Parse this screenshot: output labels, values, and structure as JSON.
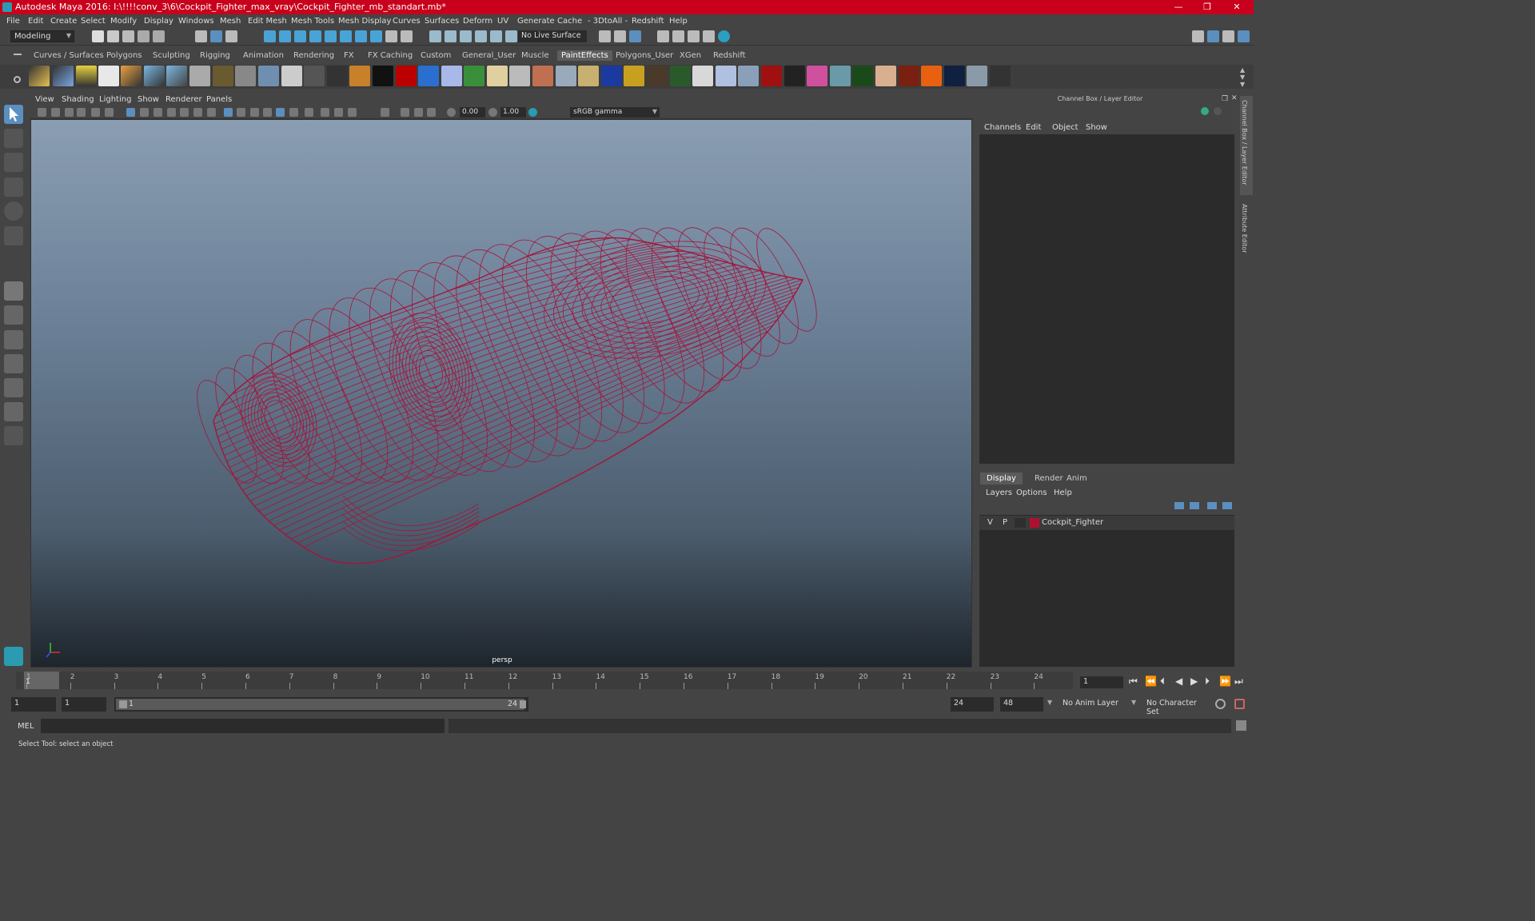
{
  "window": {
    "title": "Autodesk Maya 2016: I:\\!!!!conv_3\\6\\Cockpit_Fighter_max_vray\\Cockpit_Fighter_mb_standart.mb*",
    "minimize": "—",
    "maximize": "❐",
    "close": "✕"
  },
  "menus": [
    "File",
    "Edit",
    "Create",
    "Select",
    "Modify",
    "Display",
    "Windows",
    "Mesh",
    "Edit Mesh",
    "Mesh Tools",
    "Mesh Display",
    "Curves",
    "Surfaces",
    "Deform",
    "UV",
    "Generate",
    "Cache",
    "- 3DtoAll -",
    "Redshift",
    "Help"
  ],
  "status_line": {
    "mode": "Modeling",
    "live_surface": "No Live Surface"
  },
  "shelf_tabs": [
    "Curves / Surfaces",
    "Polygons",
    "Sculpting",
    "Rigging",
    "Animation",
    "Rendering",
    "FX",
    "FX Caching",
    "Custom",
    "General_User",
    "Muscle",
    "PaintEffects",
    "Polygons_User",
    "XGen",
    "Redshift"
  ],
  "active_shelf": "PaintEffects",
  "viewport": {
    "menu": [
      "View",
      "Shading",
      "Lighting",
      "Show",
      "Renderer",
      "Panels"
    ],
    "exposure": "0.00",
    "gamma": "1.00",
    "color_space": "sRGB gamma",
    "camera_label": "persp",
    "mesh_color": "#a3163a"
  },
  "channel_box": {
    "title": "Channel Box / Layer Editor",
    "menu": [
      "Channels",
      "Edit",
      "Object",
      "Show"
    ]
  },
  "layer_editor": {
    "tabs": [
      "Display",
      "Render",
      "Anim"
    ],
    "active_tab": "Display",
    "menu": [
      "Layers",
      "Options",
      "Help"
    ],
    "layers": [
      {
        "v": "V",
        "p": "P",
        "color": "#b01030",
        "name": "Cockpit_Fighter"
      }
    ]
  },
  "side_tabs": [
    "Channel Box / Layer Editor",
    "Attribute Editor"
  ],
  "timeline": {
    "ticks": [
      "1",
      "2",
      "3",
      "4",
      "5",
      "6",
      "7",
      "8",
      "9",
      "10",
      "11",
      "12",
      "13",
      "14",
      "15",
      "16",
      "17",
      "18",
      "19",
      "20",
      "21",
      "22",
      "23",
      "24"
    ],
    "current_frame_marker": "1",
    "current_frame": "1"
  },
  "range": {
    "start": "1",
    "playback_start": "1",
    "slider_start": "1",
    "slider_end": "24",
    "playback_end": "24",
    "end": "48",
    "anim_layer": "No Anim Layer",
    "character_set": "No Character Set"
  },
  "command_line": {
    "label": "MEL"
  },
  "help_line": "Select Tool: select an object"
}
